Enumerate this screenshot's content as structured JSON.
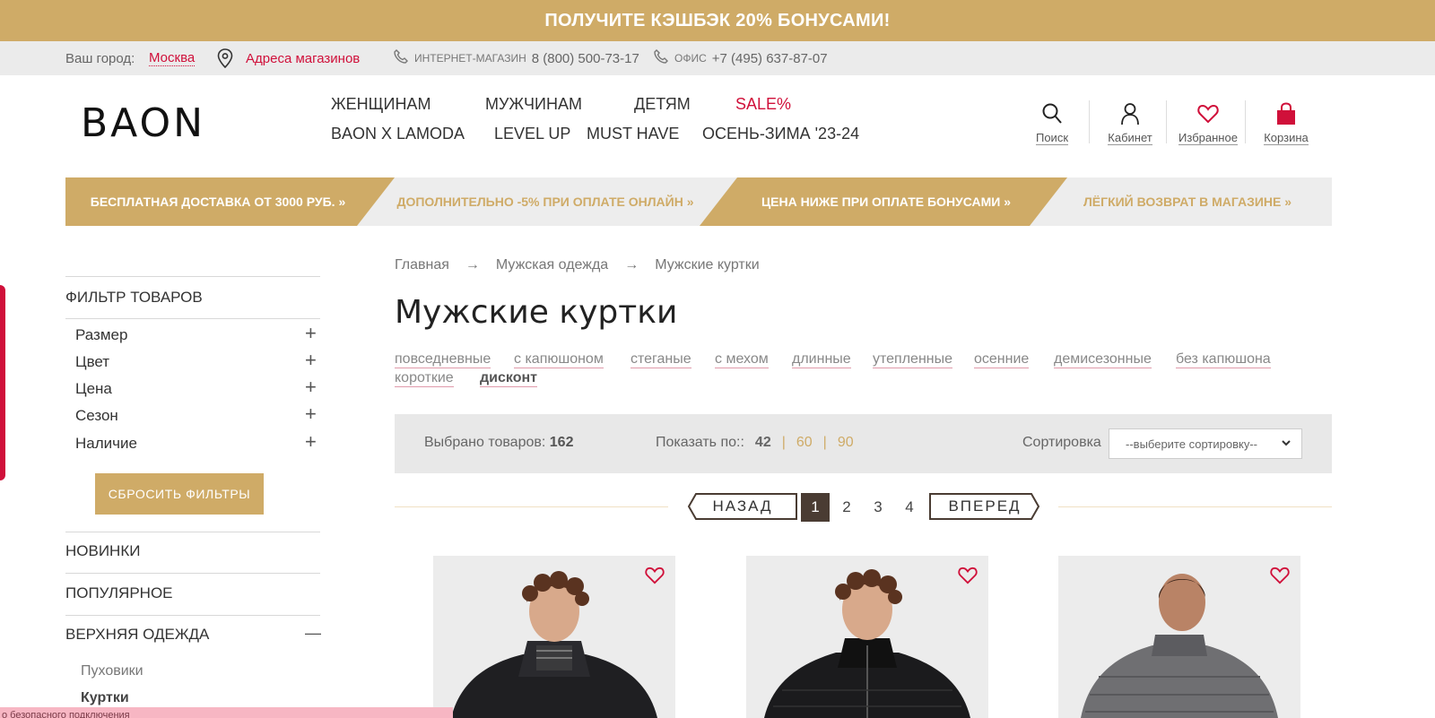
{
  "promo_banner": "ПОЛУЧИТЕ КЭШБЭК 20% БОНУСАМИ!",
  "infobar": {
    "city_label": "Ваш город:",
    "city": "Москва",
    "stores_link": "Адреса магазинов",
    "eshop_label": "ИНТЕРНЕТ-МАГАЗИН",
    "eshop_phone": "8 (800) 500-73-17",
    "office_label": "ОФИС",
    "office_phone": "+7 (495) 637-87-07"
  },
  "header": {
    "logo": "BAON",
    "nav_row1": [
      "ЖЕНЩИНАМ",
      "МУЖЧИНАМ",
      "ДЕТЯМ",
      "SALE%"
    ],
    "nav_row2": [
      "BAON X LAMODA",
      "LEVEL UP",
      "MUST HAVE",
      "ОСЕНЬ-ЗИМА '23-24"
    ],
    "icons": {
      "search": "Поиск",
      "account": "Кабинет",
      "favorites": "Избранное",
      "cart": "Корзина"
    }
  },
  "benefits": [
    "БЕСПЛАТНАЯ ДОСТАВКА ОТ 3000 РУБ.",
    "ДОПОЛНИТЕЛЬНО -5% ПРИ ОПЛАТЕ ОНЛАЙН",
    "ЦЕНА НИЖЕ ПРИ ОПЛАТЕ БОНУСАМИ",
    "ЛЁГКИЙ ВОЗВРАТ В МАГАЗИНЕ"
  ],
  "breadcrumb": {
    "items": [
      "Главная",
      "Мужская одежда",
      "Мужские куртки"
    ],
    "separator": "→"
  },
  "page_title": "Мужские куртки",
  "tags": [
    "повседневные",
    "с капюшоном",
    "стеганые",
    "с мехом",
    "длинные",
    "утепленные",
    "осенние",
    "демисезонные",
    "без капюшона",
    "короткие",
    "дисконт"
  ],
  "toolbar": {
    "count_label": "Выбрано товаров:",
    "count": "162",
    "per_page_label": "Показать по::",
    "per_page_options": [
      "42",
      "60",
      "90"
    ],
    "per_page_sep": "|",
    "sort_label": "Сортировка",
    "sort_value": "--выберите сортировку--"
  },
  "pagination": {
    "prev": "НАЗАД",
    "next": "ВПЕРЕД",
    "pages": [
      "1",
      "2",
      "3",
      "4"
    ],
    "current": "1"
  },
  "sidebar": {
    "filter_heading": "ФИЛЬТР ТОВАРОВ",
    "filters": [
      "Размер",
      "Цвет",
      "Цена",
      "Сезон",
      "Наличие"
    ],
    "expand_symbol": "+",
    "collapse_symbol": "—",
    "reset_button": "СБРОСИТЬ ФИЛЬТРЫ",
    "sections": [
      "НОВИНКИ",
      "ПОПУЛЯРНОЕ",
      "ВЕРХНЯЯ ОДЕЖДА"
    ],
    "subitems": [
      "Пуховики",
      "Куртки"
    ]
  },
  "footer_notice": "о безопасного подключения",
  "colors": {
    "gold": "#cfab67",
    "red": "#d0103a",
    "dark": "#4a3c33",
    "grey_bg": "#ebebeb"
  }
}
